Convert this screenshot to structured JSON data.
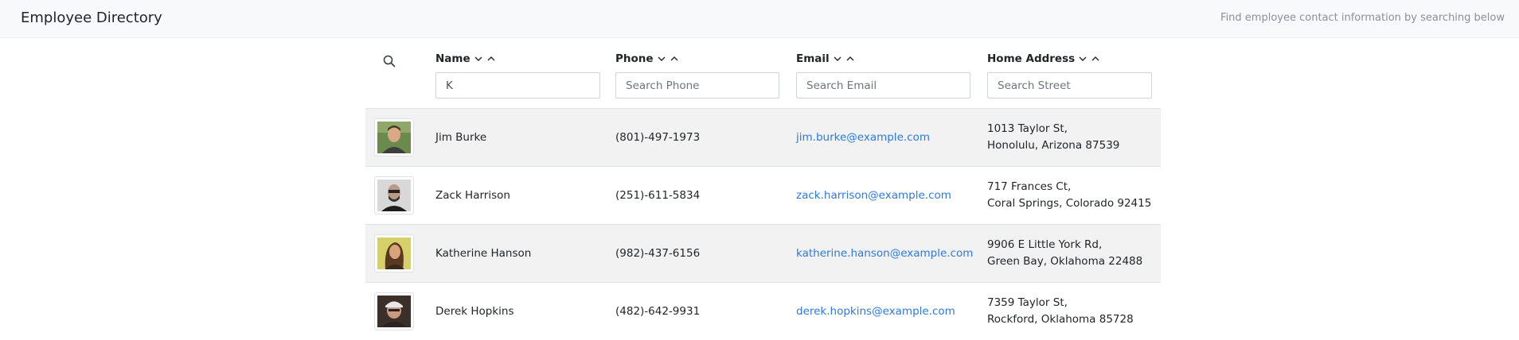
{
  "app": {
    "title": "Employee Directory",
    "tagline": "Find employee contact information by searching below"
  },
  "columns": [
    {
      "label": "Name",
      "filter_value": "K",
      "filter_placeholder": ""
    },
    {
      "label": "Phone",
      "filter_value": "",
      "filter_placeholder": "Search Phone"
    },
    {
      "label": "Email",
      "filter_value": "",
      "filter_placeholder": "Search Email"
    },
    {
      "label": "Home Address",
      "filter_value": "",
      "filter_placeholder": "Search Street"
    }
  ],
  "employees": [
    {
      "name": "Jim Burke",
      "phone": "(801)-497-1973",
      "email": "jim.burke@example.com",
      "street": "1013 Taylor St,",
      "city": "Honolulu, Arizona 87539"
    },
    {
      "name": "Zack Harrison",
      "phone": "(251)-611-5834",
      "email": "zack.harrison@example.com",
      "street": "717 Frances Ct,",
      "city": "Coral Springs, Colorado 92415"
    },
    {
      "name": "Katherine Hanson",
      "phone": "(982)-437-6156",
      "email": "katherine.hanson@example.com",
      "street": "9906 E Little York Rd,",
      "city": "Green Bay, Oklahoma 22488"
    },
    {
      "name": "Derek Hopkins",
      "phone": "(482)-642-9931",
      "email": "derek.hopkins@example.com",
      "street": "7359 Taylor St,",
      "city": "Rockford, Oklahoma 85728"
    }
  ],
  "icons": {
    "search": "search-icon",
    "sort_down": "chevron-down-icon",
    "sort_up": "chevron-up-icon"
  },
  "colors": {
    "link": "#2a7ae2",
    "stripe": "#f2f2f2",
    "topbar": "#f8f9fa"
  }
}
